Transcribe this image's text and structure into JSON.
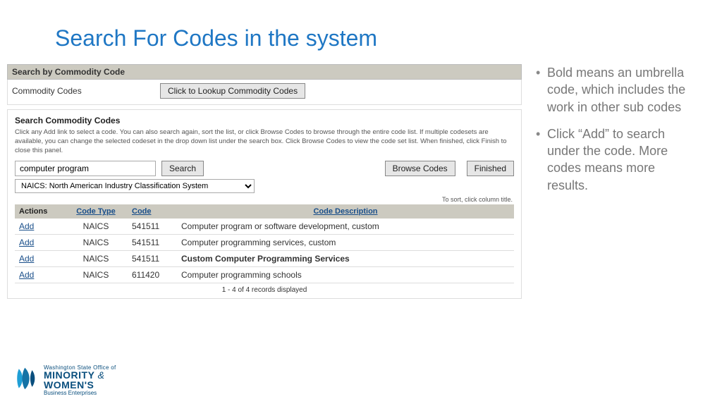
{
  "slide": {
    "title": "Search For Codes in the system"
  },
  "header": {
    "label": "Search by Commodity Code"
  },
  "lookup": {
    "label": "Commodity Codes",
    "button": "Click to Lookup Commodity Codes"
  },
  "panel": {
    "title": "Search Commodity Codes",
    "help": "Click any Add link to select a code. You can also search again, sort the list, or click Browse Codes to browse through the entire code list. If multiple codesets are available, you can change the selected codeset in the drop down list under the search box. Click Browse Codes to view the code set list. When finished, click Finish to close this panel.",
    "search_value": "computer program",
    "search_button": "Search",
    "browse_button": "Browse Codes",
    "finished_button": "Finished",
    "codeset_selected": "NAICS: North American Industry Classification System",
    "sort_hint": "To sort, click column title."
  },
  "table": {
    "cols": {
      "actions": "Actions",
      "codetype": "Code Type",
      "code": "Code",
      "desc": "Code Description"
    },
    "add_label": "Add",
    "rows": [
      {
        "codetype": "NAICS",
        "code": "541511",
        "desc": "Computer program or software development, custom",
        "bold": false
      },
      {
        "codetype": "NAICS",
        "code": "541511",
        "desc": "Computer programming services, custom",
        "bold": false
      },
      {
        "codetype": "NAICS",
        "code": "541511",
        "desc": "Custom Computer Programming Services",
        "bold": true
      },
      {
        "codetype": "NAICS",
        "code": "611420",
        "desc": "Computer programming schools",
        "bold": false
      }
    ],
    "footer": "1 - 4 of 4 records displayed"
  },
  "bullets": [
    "Bold means an umbrella code, which includes the work in other sub codes",
    "Click “Add” to search under the code. More codes means more results."
  ],
  "logo": {
    "line1": "Washington State Office of",
    "line2a": "MINORITY",
    "line2b": "WOMEN'S",
    "line3": "Business Enterprises"
  }
}
